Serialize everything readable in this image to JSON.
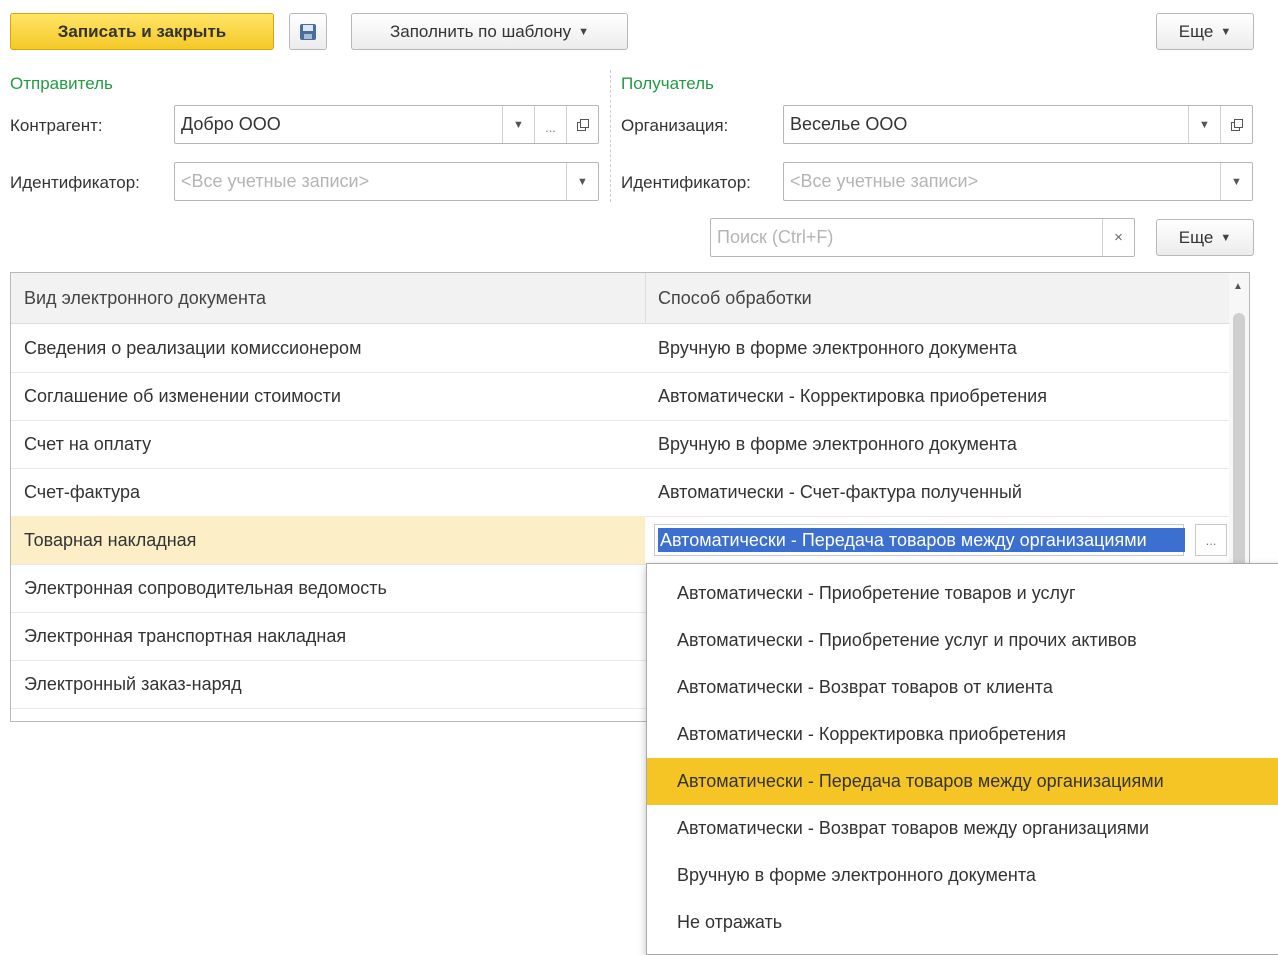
{
  "toolbar": {
    "save_close_label": "Записать и закрыть",
    "fill_template_label": "Заполнить по шаблону",
    "more_label": "Еще"
  },
  "sender": {
    "title": "Отправитель",
    "counterparty_label": "Контрагент:",
    "counterparty_value": "Добро ООО",
    "identifier_label": "Идентификатор:",
    "identifier_placeholder": "<Все учетные записи>"
  },
  "receiver": {
    "title": "Получатель",
    "organization_label": "Организация:",
    "organization_value": "Веселье ООО",
    "identifier_label": "Идентификатор:",
    "identifier_placeholder": "<Все учетные записи>"
  },
  "search": {
    "placeholder": "Поиск (Ctrl+F)",
    "more_label": "Еще"
  },
  "table": {
    "headers": [
      "Вид электронного документа",
      "Способ обработки"
    ],
    "rows": [
      [
        "Сведения о реализации комиссионером",
        "Вручную в форме электронного документа"
      ],
      [
        "Соглашение об изменении стоимости",
        "Автоматически -  Корректировка приобретения"
      ],
      [
        "Счет на оплату",
        "Вручную в форме электронного документа"
      ],
      [
        "Счет-фактура",
        "Автоматически -  Счет-фактура полученный"
      ],
      [
        "Товарная накладная",
        "Автоматически -  Передача товаров между организациями"
      ],
      [
        "Электронная сопроводительная ведомость",
        ""
      ],
      [
        "Электронная транспортная накладная",
        ""
      ],
      [
        "Электронный заказ-наряд",
        ""
      ]
    ],
    "selected_row": 4,
    "edit_button_label": "..."
  },
  "dropdown": {
    "items": [
      "Автоматически -  Приобретение товаров и услуг",
      "Автоматически -  Приобретение услуг и прочих активов",
      "Автоматически -  Возврат товаров от клиента",
      "Автоматически -  Корректировка приобретения",
      "Автоматически -  Передача товаров между организациями",
      "Автоматически -  Возврат товаров между организациями",
      "Вручную в форме электронного документа",
      "Не отражать"
    ],
    "active_index": 4
  },
  "colors": {
    "accent_yellow": "#f5c526",
    "section_green": "#239b43",
    "selection_blue": "#3b6fd0",
    "selected_row_bg": "#fcefc8"
  },
  "icons": [
    "save-icon",
    "caret-down-icon",
    "open-form-icon",
    "clear-icon",
    "scroll-up-icon"
  ]
}
